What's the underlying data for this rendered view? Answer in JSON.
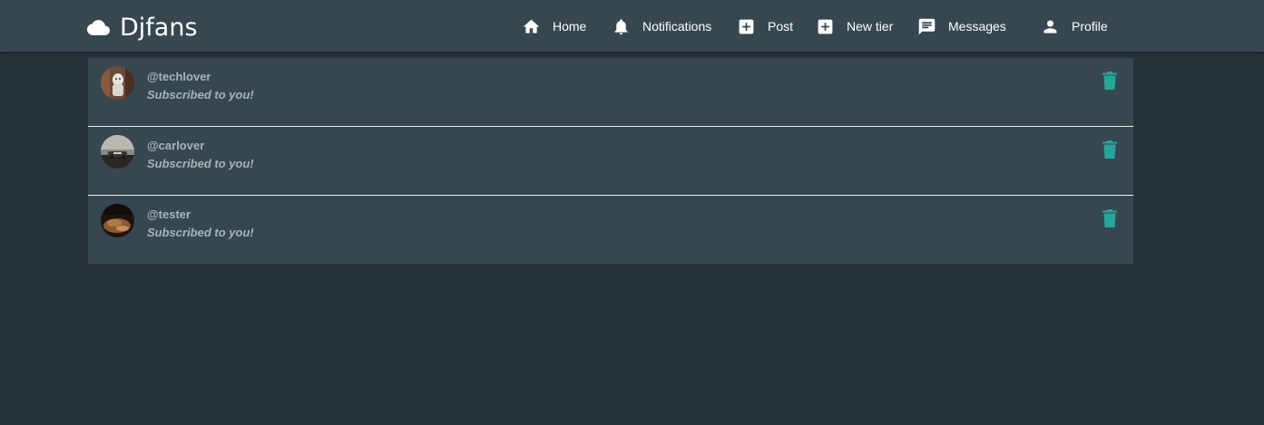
{
  "brand": {
    "name": "Djfans",
    "icon": "cloud-icon"
  },
  "nav": {
    "home": "Home",
    "notifications": "Notifications",
    "post": "Post",
    "new_tier": "New tier",
    "messages": "Messages",
    "profile": "Profile"
  },
  "colors": {
    "background": "#263238",
    "navbar": "#37474f",
    "card": "#37474f",
    "accent": "#26a69a",
    "muted_text": "#a9b3b8"
  },
  "notifications": [
    {
      "username": "@techlover",
      "message": "Subscribed to you!",
      "avatar": "avatar-techlover"
    },
    {
      "username": "@carlover",
      "message": "Subscribed to you!",
      "avatar": "avatar-carlover"
    },
    {
      "username": "@tester",
      "message": "Subscribed to you!",
      "avatar": "avatar-tester"
    }
  ]
}
